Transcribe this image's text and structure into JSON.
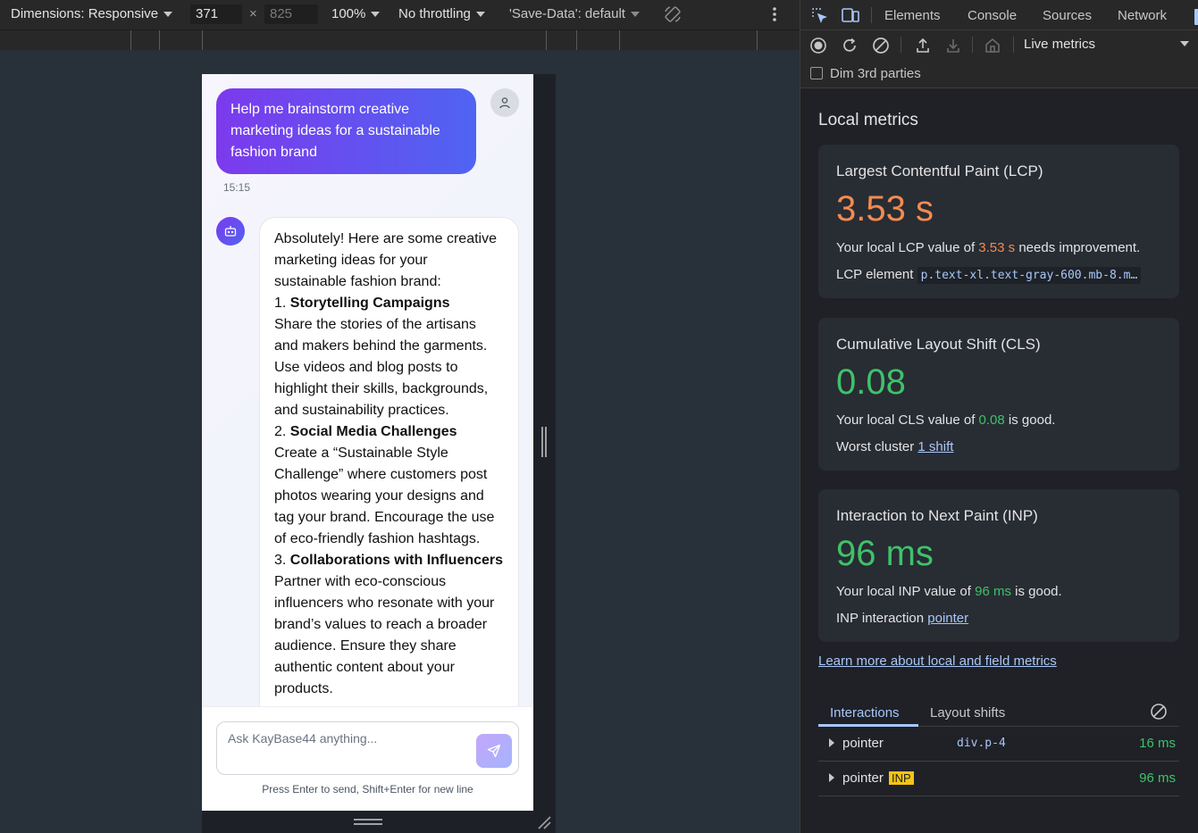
{
  "device_toolbar": {
    "dimensions_label": "Dimensions: Responsive",
    "width": "371",
    "times": "×",
    "height": "825",
    "zoom": "100%",
    "throttling": "No throttling",
    "save_data": "'Save-Data': default"
  },
  "chat": {
    "user_message": "Help me brainstorm creative marketing ideas for a sustainable fashion brand",
    "time": "15:15",
    "bot_intro": "Absolutely! Here are some creative marketing ideas for your sustainable fashion brand:",
    "items": [
      {
        "num": "1.",
        "title": "Storytelling Campaigns",
        "body": "Share the stories of the artisans and makers behind the garments. Use videos and blog posts to highlight their skills, backgrounds, and sustainability practices."
      },
      {
        "num": "2.",
        "title": "Social Media Challenges",
        "body": "Create a “Sustainable Style Challenge” where customers post photos wearing your designs and tag your brand. Encourage the use of eco-friendly fashion hashtags."
      },
      {
        "num": "3.",
        "title": "Collaborations with Influencers",
        "body": "Partner with eco-conscious influencers who resonate with your brand’s values to reach a broader audience. Ensure they share authentic content about your products."
      }
    ],
    "input_placeholder": "Ask KayBase44 anything...",
    "hint": "Press Enter to send, Shift+Enter for new line"
  },
  "devtools": {
    "tabs": [
      "Elements",
      "Console",
      "Sources",
      "Network"
    ],
    "toolbar_dropdown": "Live metrics",
    "dim_3rd_parties": "Dim 3rd parties",
    "section_title": "Local metrics",
    "lcp": {
      "title": "Largest Contentful Paint (LCP)",
      "value": "3.53 s",
      "desc_prefix": "Your local LCP value of ",
      "desc_value": "3.53 s",
      "desc_suffix": " needs improvement.",
      "meta_label": "LCP element",
      "meta_value": "p.text-xl.text-gray-600.mb-8.m…"
    },
    "cls": {
      "title": "Cumulative Layout Shift (CLS)",
      "value": "0.08",
      "desc_prefix": "Your local CLS value of ",
      "desc_value": "0.08",
      "desc_suffix": " is good.",
      "meta_label": "Worst cluster",
      "meta_value": "1 shift"
    },
    "inp": {
      "title": "Interaction to Next Paint (INP)",
      "value": "96 ms",
      "desc_prefix": "Your local INP value of ",
      "desc_value": "96 ms",
      "desc_suffix": " is good.",
      "meta_label": "INP interaction",
      "meta_value": "pointer"
    },
    "learn_more": "Learn more about local and field metrics",
    "subtabs": [
      "Interactions",
      "Layout shifts"
    ],
    "interactions": [
      {
        "name": "pointer",
        "target": "div.p-4",
        "badge": "",
        "duration": "16 ms"
      },
      {
        "name": "pointer",
        "target": "",
        "badge": "INP",
        "duration": "96 ms"
      }
    ],
    "colors": {
      "needs_improvement": "#f28b50",
      "good": "#3ec26a",
      "link": "#a8c7fa"
    }
  }
}
